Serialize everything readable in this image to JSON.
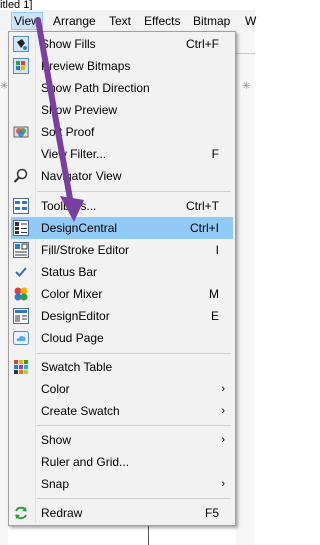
{
  "title_fragment": "itled 1]",
  "menubar": {
    "items": [
      "View",
      "Arrange",
      "Text",
      "Effects",
      "Bitmap",
      "W"
    ]
  },
  "menu": {
    "items": [
      {
        "id": "show-fills",
        "label": "Show Fills",
        "shortcut": "Ctrl+F",
        "icon": "show-fills-icon"
      },
      {
        "id": "preview-bitmaps",
        "label": "Preview Bitmaps",
        "shortcut": "",
        "icon": "preview-bitmaps-icon"
      },
      {
        "id": "show-path-direction",
        "label": "Show Path Direction",
        "shortcut": "",
        "icon": ""
      },
      {
        "id": "show-preview",
        "label": "Show Preview",
        "shortcut": "",
        "icon": ""
      },
      {
        "id": "soft-proof",
        "label": "Soft Proof",
        "shortcut": "",
        "icon": "soft-proof-icon"
      },
      {
        "id": "view-filter",
        "label": "View Filter...",
        "shortcut": "F",
        "icon": ""
      },
      {
        "id": "navigator-view",
        "label": "Navigator View",
        "shortcut": "",
        "icon": "navigator-icon"
      },
      {
        "id": "toolbars",
        "label": "Toolbars...",
        "shortcut": "Ctrl+T",
        "icon": "toolbars-icon"
      },
      {
        "id": "designcentral",
        "label": "DesignCentral",
        "shortcut": "Ctrl+I",
        "icon": "designcentral-icon"
      },
      {
        "id": "fill-stroke-editor",
        "label": "Fill/Stroke Editor",
        "shortcut": "I",
        "icon": "fill-stroke-icon"
      },
      {
        "id": "status-bar",
        "label": "Status Bar",
        "shortcut": "",
        "icon": "checkmark-icon"
      },
      {
        "id": "color-mixer",
        "label": "Color Mixer",
        "shortcut": "M",
        "icon": "color-mixer-icon"
      },
      {
        "id": "designeditor",
        "label": "DesignEditor",
        "shortcut": "E",
        "icon": "designeditor-icon"
      },
      {
        "id": "cloud-page",
        "label": "Cloud Page",
        "shortcut": "",
        "icon": "cloud-page-icon"
      },
      {
        "id": "swatch-table",
        "label": "Swatch Table",
        "shortcut": "",
        "icon": "swatch-table-icon"
      },
      {
        "id": "color",
        "label": "Color",
        "shortcut": "",
        "icon": "",
        "submenu": "›"
      },
      {
        "id": "create-swatch",
        "label": "Create Swatch",
        "shortcut": "",
        "icon": "",
        "submenu": "›"
      },
      {
        "id": "show",
        "label": "Show",
        "shortcut": "",
        "icon": "",
        "submenu": "›"
      },
      {
        "id": "ruler-and-grid",
        "label": "Ruler and Grid...",
        "shortcut": "",
        "icon": ""
      },
      {
        "id": "snap",
        "label": "Snap",
        "shortcut": "",
        "icon": "",
        "submenu": "›"
      },
      {
        "id": "redraw",
        "label": "Redraw",
        "shortcut": "F5",
        "icon": "redraw-icon"
      }
    ],
    "highlighted": "DesignCentral"
  },
  "colors": {
    "highlight": "#91c9f7",
    "menu_bg": "#f2f2f2",
    "annotation_arrow": "#7b3fa0"
  }
}
